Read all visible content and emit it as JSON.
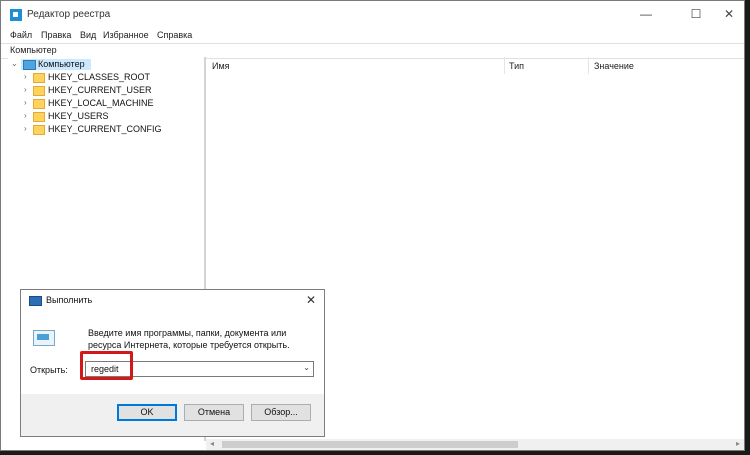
{
  "window": {
    "title": "Редактор реестра",
    "controls": {
      "minimize": "—",
      "maximize": "☐",
      "close": "✕"
    }
  },
  "menu": [
    "Файл",
    "Правка",
    "Вид",
    "Избранное",
    "Справка"
  ],
  "address": "Компьютер",
  "tree": {
    "root": "Компьютер",
    "items": [
      "HKEY_CLASSES_ROOT",
      "HKEY_CURRENT_USER",
      "HKEY_LOCAL_MACHINE",
      "HKEY_USERS",
      "HKEY_CURRENT_CONFIG"
    ]
  },
  "columns": [
    "Имя",
    "Тип",
    "Значение"
  ],
  "run_dialog": {
    "title": "Выполнить",
    "close": "✕",
    "description": "Введите имя программы, папки, документа или ресурса Интернета, которые требуется открыть.",
    "open_label": "Открыть:",
    "input_value": "regedit",
    "buttons": {
      "ok": "OK",
      "cancel": "Отмена",
      "browse": "Обзор..."
    }
  },
  "colors": {
    "highlight": "#d21919",
    "accent": "#0078d7",
    "selection": "#cce8ff"
  }
}
